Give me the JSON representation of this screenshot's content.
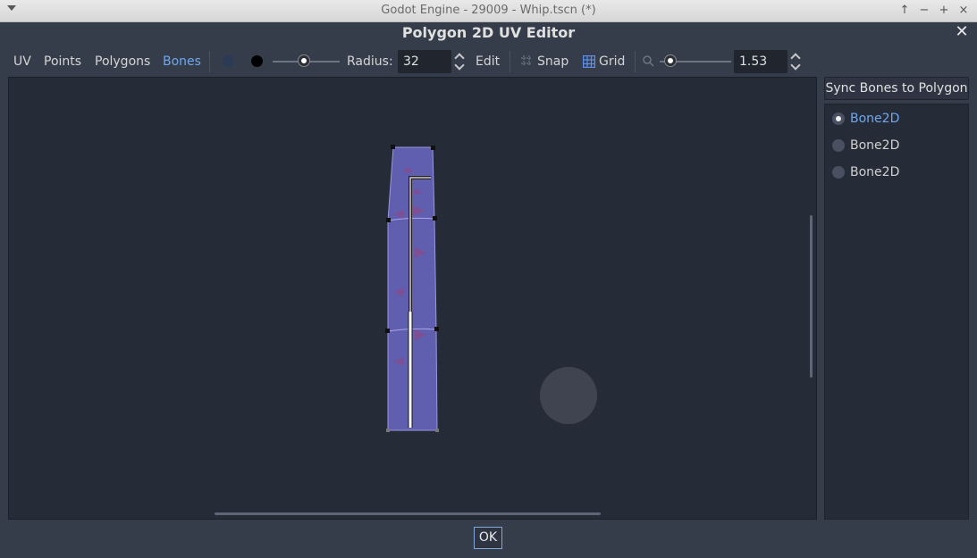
{
  "window": {
    "title": "Godot Engine - 29009 - Whip.tscn (*)"
  },
  "dialog": {
    "title": "Polygon 2D UV Editor",
    "ok_label": "OK"
  },
  "toolbar": {
    "modes": [
      "UV",
      "Points",
      "Polygons",
      "Bones"
    ],
    "active_mode": "Bones",
    "paint_colors": [
      "#2b3a55",
      "#000000"
    ],
    "radius_label": "Radius:",
    "radius_value": "32",
    "edit_label": "Edit",
    "snap_label": "Snap",
    "grid_label": "Grid",
    "zoom_value": "1.53"
  },
  "side_panel": {
    "sync_button": "Sync Bones to Polygon",
    "bones": [
      {
        "label": "Bone2D",
        "selected": true
      },
      {
        "label": "Bone2D",
        "selected": false
      },
      {
        "label": "Bone2D",
        "selected": false
      }
    ]
  },
  "colors": {
    "accent": "#6fa7ee",
    "polygon_fill": "#6b68c4",
    "canvas_bg": "#262b38"
  }
}
